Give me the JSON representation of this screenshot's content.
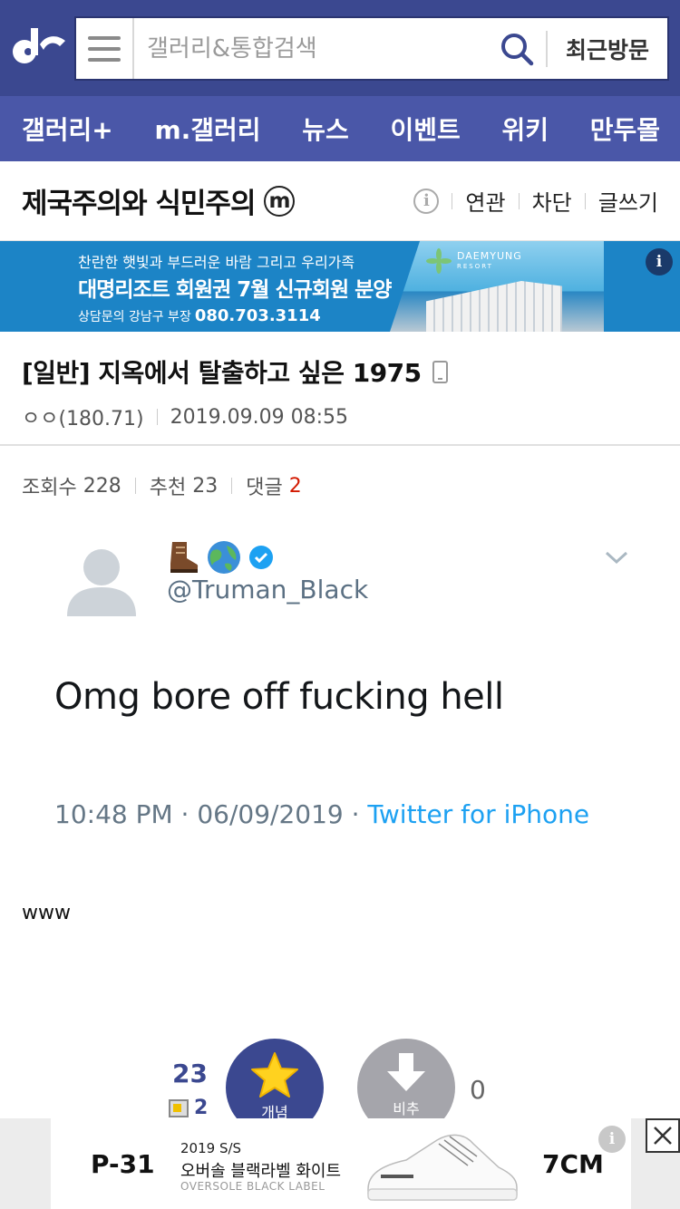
{
  "header": {
    "search_placeholder": "갤러리&통합검색",
    "recent_label": "최근방문",
    "brand_color": "#3b4890"
  },
  "nav": {
    "items": [
      {
        "label": "갤러리+"
      },
      {
        "label": "m.갤러리"
      },
      {
        "label": "뉴스"
      },
      {
        "label": "이벤트"
      },
      {
        "label": "위키"
      },
      {
        "label": "만두몰"
      }
    ]
  },
  "gallery": {
    "title": "제국주의와 식민주의",
    "badge": "m",
    "actions": {
      "related": "연관",
      "block": "차단",
      "write": "글쓰기"
    }
  },
  "banner_ad": {
    "line1": "찬란한 햇빛과 부드러운 바람 그리고 우리가족",
    "line2": "대명리조트 회원권 7월 신규회원 분양",
    "line3_label": "상담문의 강남구 부장",
    "phone": "080.703.3114",
    "brand": "DAEMYUNG",
    "brand_sub": "RESORT",
    "info": "i"
  },
  "post": {
    "title": "[일반] 지옥에서 탈출하고 싶은 1975",
    "author": "ㅇㅇ(180.71)",
    "date": "2019.09.09 08:55",
    "stats": {
      "views_label": "조회수",
      "views": "228",
      "recommend_label": "추천",
      "recommend": "23",
      "comments_label": "댓글",
      "comments": "2"
    },
    "body_text": "www"
  },
  "tweet": {
    "emojis": [
      "boot-emoji",
      "globe-emoji",
      "verified-badge"
    ],
    "handle": "@Truman_Black",
    "text": "Omg bore off fucking hell",
    "time": "10:48 PM · 06/09/2019 · ",
    "source": "Twitter for iPhone"
  },
  "vote": {
    "up_count": "23",
    "fixed_count": "2",
    "up_label": "개념",
    "down_label": "비추",
    "down_count": "0"
  },
  "bottom_ad": {
    "code": "P-31",
    "season": "2019 S/S",
    "name_kr": "오버솔 블랙라벨 화이트",
    "name_en": "OVERSOLE BLACK LABEL",
    "height": "7CM",
    "info": "i"
  }
}
